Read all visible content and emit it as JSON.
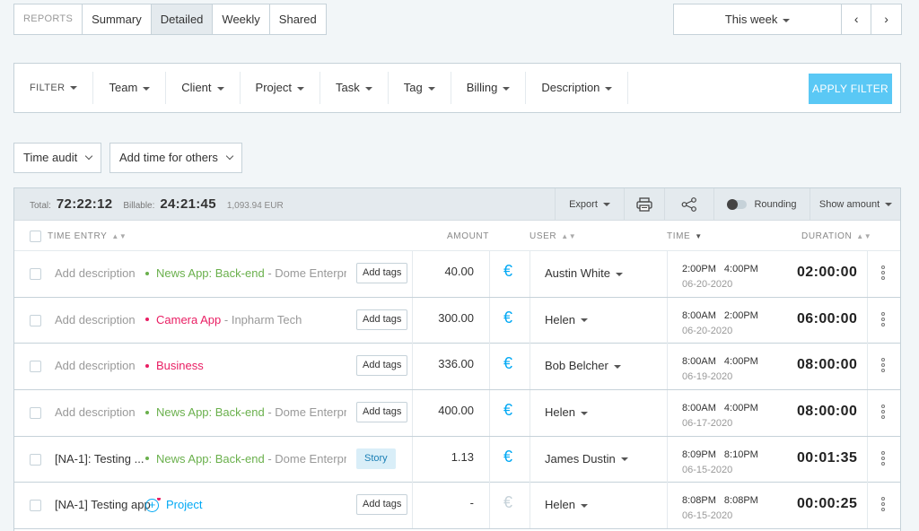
{
  "tabs": [
    {
      "label": "REPORTS",
      "kind": "reports"
    },
    {
      "label": "Summary",
      "kind": ""
    },
    {
      "label": "Detailed",
      "kind": "active"
    },
    {
      "label": "Weekly",
      "kind": ""
    },
    {
      "label": "Shared",
      "kind": ""
    }
  ],
  "date_range": {
    "label": "This week",
    "prev_icon": "chevron-left-icon",
    "next_icon": "chevron-right-icon"
  },
  "filters": {
    "label": "FILTER",
    "items": [
      "Team",
      "Client",
      "Project",
      "Task",
      "Tag",
      "Billing",
      "Description"
    ],
    "apply_label": "APPLY FILTER",
    "apply_color": "#5ac8f5"
  },
  "dropdowns": {
    "time_audit": "Time audit",
    "add_time": "Add time for others"
  },
  "summary": {
    "total_label": "Total:",
    "total_value": "72:22:12",
    "billable_label": "Billable:",
    "billable_value": "24:21:45",
    "amount": "1,093.94 EUR",
    "export_label": "Export",
    "rounding_label": "Rounding",
    "show_amount_label": "Show amount"
  },
  "columns": {
    "time_entry": "TIME ENTRY",
    "amount": "AMOUNT",
    "user": "USER",
    "time": "TIME",
    "duration": "DURATION"
  },
  "rows": [
    {
      "description": "Add description",
      "desc_filled": false,
      "project": "News App: Back-end",
      "project_color": "#6ab04c",
      "client": "- Dome Enterpri...",
      "tag": "Add tags",
      "tag_kind": "",
      "amount": "40.00",
      "billable": true,
      "user": "Austin White",
      "start": "2:00PM",
      "end": "4:00PM",
      "date": "06-20-2020",
      "duration": "02:00:00"
    },
    {
      "description": "Add description",
      "desc_filled": false,
      "project": "Camera App",
      "project_color": "#e91e63",
      "client": "- Inpharm Tech",
      "tag": "Add tags",
      "tag_kind": "",
      "amount": "300.00",
      "billable": true,
      "user": "Helen",
      "start": "8:00AM",
      "end": "2:00PM",
      "date": "06-20-2020",
      "duration": "06:00:00"
    },
    {
      "description": "Add description",
      "desc_filled": false,
      "project": "Business",
      "project_color": "#e91e63",
      "client": "",
      "tag": "Add tags",
      "tag_kind": "",
      "amount": "336.00",
      "billable": true,
      "user": "Bob Belcher",
      "start": "8:00AM",
      "end": "4:00PM",
      "date": "06-19-2020",
      "duration": "08:00:00"
    },
    {
      "description": "Add description",
      "desc_filled": false,
      "project": "News App: Back-end",
      "project_color": "#6ab04c",
      "client": "- Dome Enterpri...",
      "tag": "Add tags",
      "tag_kind": "",
      "amount": "400.00",
      "billable": true,
      "user": "Helen",
      "start": "8:00AM",
      "end": "4:00PM",
      "date": "06-17-2020",
      "duration": "08:00:00"
    },
    {
      "description": "[NA-1]: Testing ...",
      "desc_filled": true,
      "project": "News App: Back-end",
      "project_color": "#6ab04c",
      "client": "- Dome Enterpri...",
      "tag": "Story",
      "tag_kind": "story",
      "amount": "1.13",
      "billable": true,
      "user": "James Dustin",
      "start": "8:09PM",
      "end": "8:10PM",
      "date": "06-15-2020",
      "duration": "00:01:35"
    },
    {
      "description": "[NA-1] Testing app",
      "desc_filled": true,
      "project": "Project",
      "project_color": "#03a9f4",
      "client": "",
      "tag": "Add tags",
      "tag_kind": "",
      "amount": "-",
      "billable": false,
      "user": "Helen",
      "start": "8:08PM",
      "end": "8:08PM",
      "date": "06-15-2020",
      "duration": "00:00:25",
      "no_project": true
    }
  ]
}
